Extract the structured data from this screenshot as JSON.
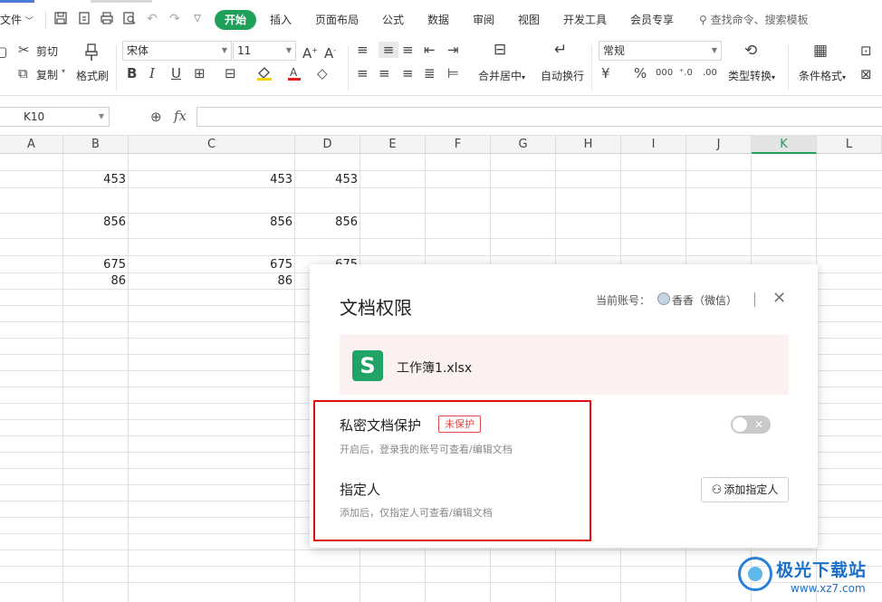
{
  "menubar": {
    "file_label": "文件",
    "tabs": [
      "开始",
      "插入",
      "页面布局",
      "公式",
      "数据",
      "审阅",
      "视图",
      "开发工具",
      "会员专享"
    ],
    "active_tab": "开始",
    "search_label": "查找命令、搜索模板"
  },
  "ribbon": {
    "cut": "剪切",
    "copy": "复制",
    "format_painter": "格式刷",
    "font_name": "宋体",
    "font_size": "11",
    "merge_center": "合并居中",
    "wrap_text": "自动换行",
    "number_format": "常规",
    "type_convert": "类型转换",
    "conditional_format": "条件格式"
  },
  "formula_bar": {
    "cell_ref": "K10",
    "fx": "fx"
  },
  "grid": {
    "columns": [
      "A",
      "B",
      "C",
      "D",
      "E",
      "F",
      "G",
      "H",
      "I",
      "J",
      "K",
      "L"
    ],
    "active_column": "K",
    "rows": [
      {
        "b": "453",
        "c": "453",
        "d": "453"
      },
      {
        "b": "856",
        "c": "856",
        "d": "856"
      },
      {
        "b": "675",
        "c": "675",
        "d": "675"
      },
      {
        "b": "86",
        "c": "86",
        "d": ""
      }
    ]
  },
  "dialog": {
    "title": "文档权限",
    "account_label": "当前账号：",
    "account_name": "香香（微信）",
    "file_name": "工作簿1.xlsx",
    "private_title": "私密文档保护",
    "private_badge": "未保护",
    "private_desc": "开启后，登录我的账号可查看/编辑文档",
    "private_enabled": false,
    "assign_title": "指定人",
    "assign_desc": "添加后，仅指定人可查看/编辑文档",
    "add_button": "添加指定人"
  },
  "watermark": {
    "name": "极光下载站",
    "url": "www.xz7.com"
  }
}
